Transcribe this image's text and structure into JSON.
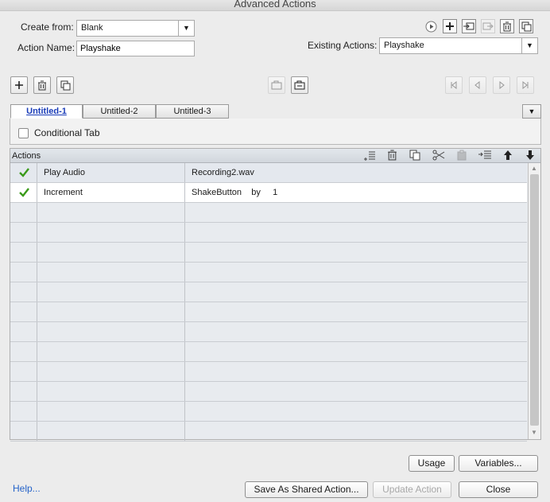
{
  "window": {
    "title": "Advanced Actions"
  },
  "form": {
    "create_from_label": "Create from:",
    "create_from_value": "Blank",
    "action_name_label": "Action Name:",
    "action_name_value": "Playshake",
    "existing_actions_label": "Existing Actions:",
    "existing_actions_value": "Playshake"
  },
  "tabs": [
    {
      "label": "Untitled-1",
      "active": true
    },
    {
      "label": "Untitled-2",
      "active": false
    },
    {
      "label": "Untitled-3",
      "active": false
    }
  ],
  "conditional_tab_label": "Conditional Tab",
  "actions_grid": {
    "header": "Actions",
    "rows": [
      {
        "checked": true,
        "action": "Play Audio",
        "target": "Recording2.wav"
      },
      {
        "checked": true,
        "action": "Increment",
        "target": "ShakeButton    by     1"
      }
    ],
    "empty_row_count": 12
  },
  "buttons": {
    "usage": "Usage",
    "variables": "Variables...",
    "save_shared": "Save As Shared Action...",
    "update": "Update Action",
    "close": "Close",
    "help": "Help..."
  },
  "colors": {
    "accent": "#1a3cb8",
    "check": "#3a9a1a",
    "link": "#2563c9"
  }
}
